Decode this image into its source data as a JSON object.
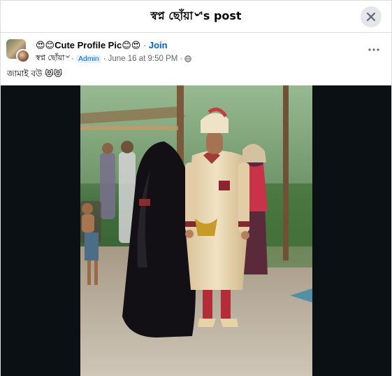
{
  "modal": {
    "title": "স্বপ্ন ছোঁয়া৺'s post",
    "close_icon": "close-icon"
  },
  "post": {
    "group_emoji_prefix": "😍😊",
    "group_name": "Cute Profile Pic",
    "group_emoji_suffix": "😊😍",
    "separator": "·",
    "join_label": "Join",
    "author_name": "স্বপ্ন ছোঁয়া৺",
    "author_badge": "Admin",
    "timestamp": "June 16 at 9:50 PM",
    "privacy_icon": "globe-icon",
    "more_icon": "more-horizontal-icon",
    "caption": "জামাই বউ 😻😻"
  },
  "colors": {
    "accent": "#0064d1",
    "secondary_text": "#65676b",
    "divider": "#dadde1",
    "media_background": "#0b1014"
  }
}
